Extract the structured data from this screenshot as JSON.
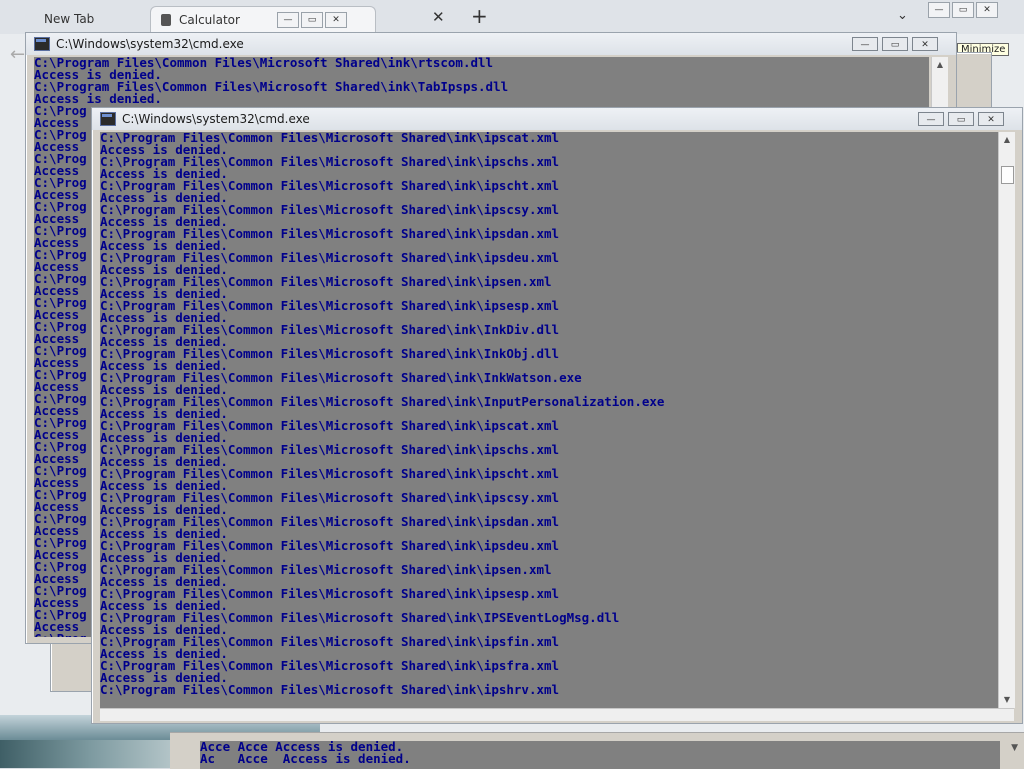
{
  "browser": {
    "tabs": [
      {
        "label": "New Tab"
      },
      {
        "label": "Calculator"
      }
    ],
    "close_symbol": "✕",
    "new_tab_symbol": "+",
    "chevron_symbol": "⌄",
    "tooltip": "Minimize"
  },
  "back_window": {
    "title": "C:\\Windows\\system32\\cmd.exe",
    "lines": [
      "C:\\Program Files\\Common Files\\Microsoft Shared\\ink\\rtscom.dll",
      "Access is denied.",
      "C:\\Program Files\\Common Files\\Microsoft Shared\\ink\\TabIpsps.dll",
      "Access is denied.",
      "C:\\Prog",
      "Access",
      "C:\\Prog",
      "Access",
      "C:\\Prog",
      "Access",
      "C:\\Prog",
      "Access",
      "C:\\Prog",
      "Access",
      "C:\\Prog",
      "Access",
      "C:\\Prog",
      "Access",
      "C:\\Prog",
      "Access",
      "C:\\Prog",
      "Access",
      "C:\\Prog",
      "Access",
      "C:\\Prog",
      "Access",
      "C:\\Prog",
      "Access",
      "C:\\Prog",
      "Access",
      "C:\\Prog",
      "Access",
      "C:\\Prog",
      "Access",
      "C:\\Prog",
      "Access",
      "C:\\Prog",
      "Access",
      "C:\\Prog",
      "Access",
      "C:\\Prog",
      "Access",
      "C:\\Prog",
      "Access",
      "C:\\Prog",
      "Access",
      "C:\\Prog",
      "Access",
      "C:\\Prog",
      "Access",
      "C:\\Prog"
    ]
  },
  "front_window": {
    "title": "C:\\Windows\\system32\\cmd.exe",
    "lines": [
      "C:\\Program Files\\Common Files\\Microsoft Shared\\ink\\ipscat.xml",
      "Access is denied.",
      "C:\\Program Files\\Common Files\\Microsoft Shared\\ink\\ipschs.xml",
      "Access is denied.",
      "C:\\Program Files\\Common Files\\Microsoft Shared\\ink\\ipscht.xml",
      "Access is denied.",
      "C:\\Program Files\\Common Files\\Microsoft Shared\\ink\\ipscsy.xml",
      "Access is denied.",
      "C:\\Program Files\\Common Files\\Microsoft Shared\\ink\\ipsdan.xml",
      "Access is denied.",
      "C:\\Program Files\\Common Files\\Microsoft Shared\\ink\\ipsdeu.xml",
      "Access is denied.",
      "C:\\Program Files\\Common Files\\Microsoft Shared\\ink\\ipsen.xml",
      "Access is denied.",
      "C:\\Program Files\\Common Files\\Microsoft Shared\\ink\\ipsesp.xml",
      "Access is denied.",
      "C:\\Program Files\\Common Files\\Microsoft Shared\\ink\\InkDiv.dll",
      "Access is denied.",
      "C:\\Program Files\\Common Files\\Microsoft Shared\\ink\\InkObj.dll",
      "Access is denied.",
      "C:\\Program Files\\Common Files\\Microsoft Shared\\ink\\InkWatson.exe",
      "Access is denied.",
      "C:\\Program Files\\Common Files\\Microsoft Shared\\ink\\InputPersonalization.exe",
      "Access is denied.",
      "C:\\Program Files\\Common Files\\Microsoft Shared\\ink\\ipscat.xml",
      "Access is denied.",
      "C:\\Program Files\\Common Files\\Microsoft Shared\\ink\\ipschs.xml",
      "Access is denied.",
      "C:\\Program Files\\Common Files\\Microsoft Shared\\ink\\ipscht.xml",
      "Access is denied.",
      "C:\\Program Files\\Common Files\\Microsoft Shared\\ink\\ipscsy.xml",
      "Access is denied.",
      "C:\\Program Files\\Common Files\\Microsoft Shared\\ink\\ipsdan.xml",
      "Access is denied.",
      "C:\\Program Files\\Common Files\\Microsoft Shared\\ink\\ipsdeu.xml",
      "Access is denied.",
      "C:\\Program Files\\Common Files\\Microsoft Shared\\ink\\ipsen.xml",
      "Access is denied.",
      "C:\\Program Files\\Common Files\\Microsoft Shared\\ink\\ipsesp.xml",
      "Access is denied.",
      "C:\\Program Files\\Common Files\\Microsoft Shared\\ink\\IPSEventLogMsg.dll",
      "Access is denied.",
      "C:\\Program Files\\Common Files\\Microsoft Shared\\ink\\ipsfin.xml",
      "Access is denied.",
      "C:\\Program Files\\Common Files\\Microsoft Shared\\ink\\ipsfra.xml",
      "Access is denied.",
      "C:\\Program Files\\Common Files\\Microsoft Shared\\ink\\ipshrv.xml"
    ]
  },
  "bottom_window": {
    "lines": [
      "Acce Acce Access is denied.",
      "Ac   Acce  Access is denied."
    ]
  },
  "window_controls": {
    "minimize": "—",
    "maximize": "▭",
    "close": "✕"
  },
  "scroll_arrows": {
    "up": "▲",
    "down": "▼"
  },
  "colors": {
    "console_bg": "#808080",
    "console_text": "#00008b"
  }
}
